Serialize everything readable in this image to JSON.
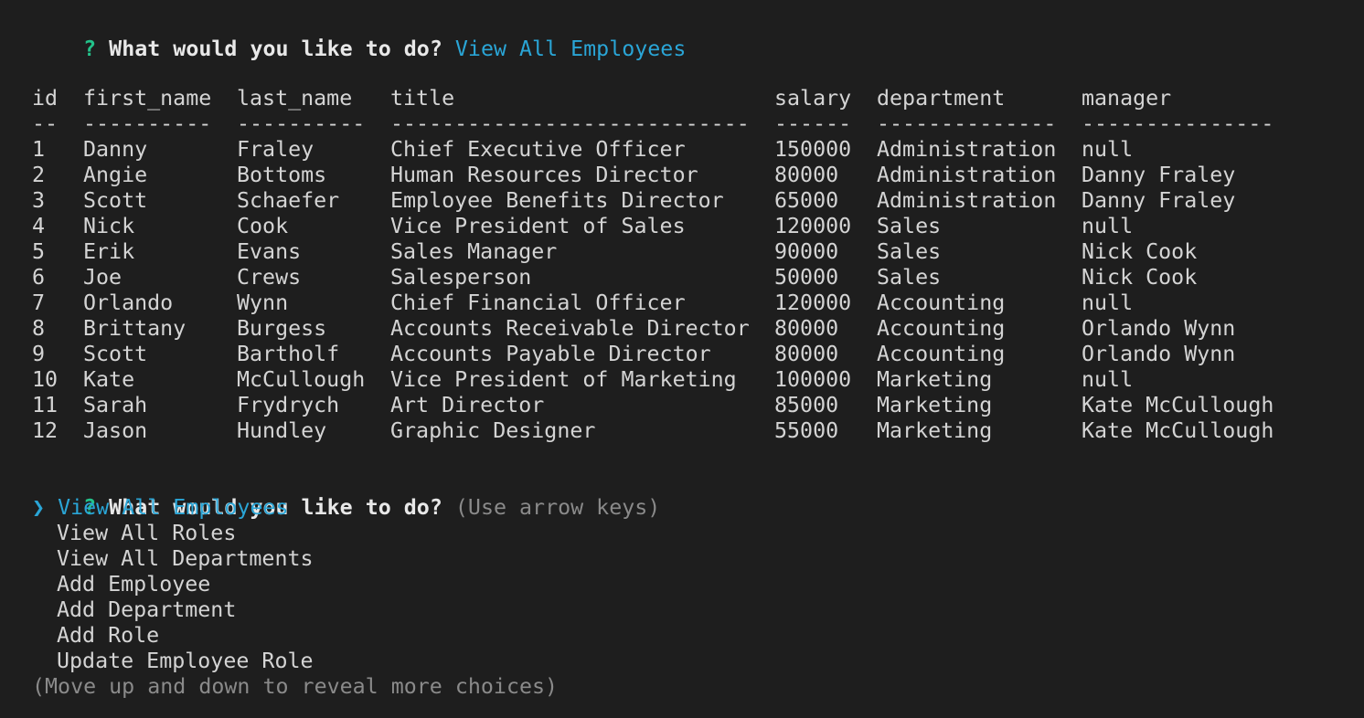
{
  "prompt1": {
    "marker": "?",
    "question": "What would you like to do?",
    "answer": "View All Employees"
  },
  "table": {
    "headers": [
      "id",
      "first_name",
      "last_name",
      "title",
      "salary",
      "department",
      "manager"
    ],
    "separators": [
      "--",
      "----------",
      "----------",
      "----------------------------",
      "------",
      "--------------",
      "---------------"
    ],
    "rows": [
      [
        "1",
        "Danny",
        "Fraley",
        "Chief Executive Officer",
        "150000",
        "Administration",
        "null"
      ],
      [
        "2",
        "Angie",
        "Bottoms",
        "Human Resources Director",
        "80000",
        "Administration",
        "Danny Fraley"
      ],
      [
        "3",
        "Scott",
        "Schaefer",
        "Employee Benefits Director",
        "65000",
        "Administration",
        "Danny Fraley"
      ],
      [
        "4",
        "Nick",
        "Cook",
        "Vice President of Sales",
        "120000",
        "Sales",
        "null"
      ],
      [
        "5",
        "Erik",
        "Evans",
        "Sales Manager",
        "90000",
        "Sales",
        "Nick Cook"
      ],
      [
        "6",
        "Joe",
        "Crews",
        "Salesperson",
        "50000",
        "Sales",
        "Nick Cook"
      ],
      [
        "7",
        "Orlando",
        "Wynn",
        "Chief Financial Officer",
        "120000",
        "Accounting",
        "null"
      ],
      [
        "8",
        "Brittany",
        "Burgess",
        "Accounts Receivable Director",
        "80000",
        "Accounting",
        "Orlando Wynn"
      ],
      [
        "9",
        "Scott",
        "Bartholf",
        "Accounts Payable Director",
        "80000",
        "Accounting",
        "Orlando Wynn"
      ],
      [
        "10",
        "Kate",
        "McCullough",
        "Vice President of Marketing",
        "100000",
        "Marketing",
        "null"
      ],
      [
        "11",
        "Sarah",
        "Frydrych",
        "Art Director",
        "85000",
        "Marketing",
        "Kate McCullough"
      ],
      [
        "12",
        "Jason",
        "Hundley",
        "Graphic Designer",
        "55000",
        "Marketing",
        "Kate McCullough"
      ]
    ]
  },
  "prompt2": {
    "marker": "?",
    "question": "What would you like to do?",
    "hint": "(Use arrow keys)",
    "pointer": "❯",
    "choices": [
      "View All Employees",
      "View All Roles",
      "View All Departments",
      "Add Employee",
      "Add Department",
      "Add Role",
      "Update Employee Role"
    ],
    "footer": "(Move up and down to reveal more choices)"
  },
  "colors": {
    "background": "#1e1e1e",
    "text": "#d4d4d4",
    "question_marker": "#23c28a",
    "answer": "#2aa5d6",
    "dim": "#8a8a8a"
  }
}
